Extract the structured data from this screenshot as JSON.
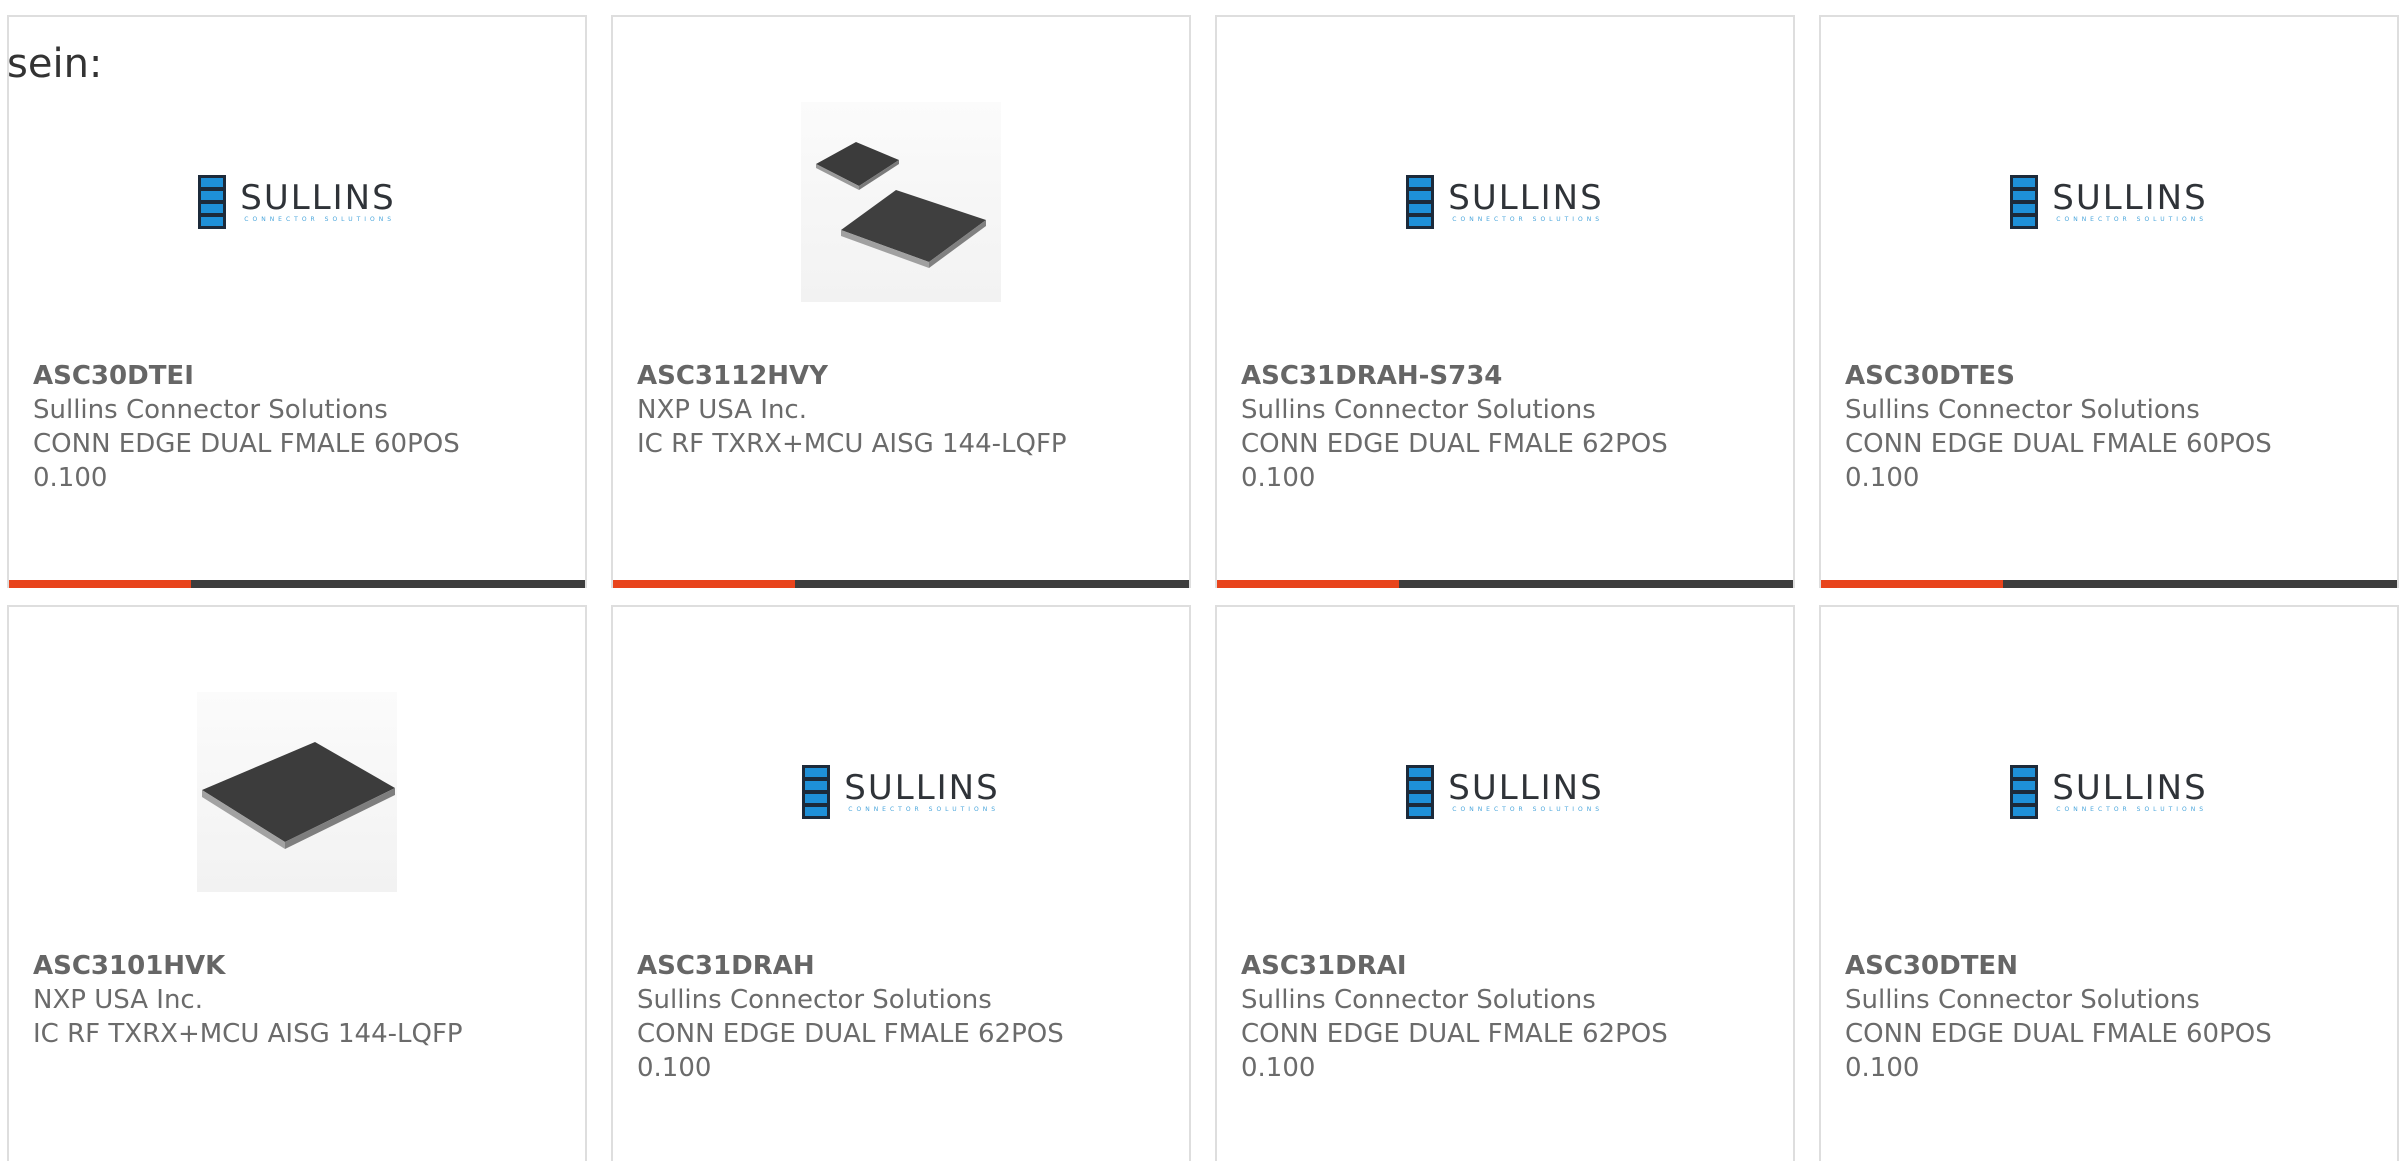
{
  "intro_text": "sein:",
  "colors": {
    "accent": "#e8441c",
    "bar": "#3d3d3d",
    "border": "#dedede",
    "logo_blue": "#1e90d8"
  },
  "logo": {
    "name": "SULLINS",
    "tagline": "CONNECTOR SOLUTIONS"
  },
  "products": [
    {
      "part_number": "ASC30DTEI",
      "manufacturer": "Sullins Connector Solutions",
      "desc_1": "CONN EDGE DUAL FMALE 60POS",
      "desc_2": "0.100",
      "image": "sullins-logo",
      "has_bar": true
    },
    {
      "part_number": "ASC3112HVY",
      "manufacturer": "NXP USA Inc.",
      "desc_1": "IC RF TXRX+MCU AISG 144-LQFP",
      "desc_2": "",
      "image": "ic-chip-pair",
      "has_bar": true
    },
    {
      "part_number": "ASC31DRAH-S734",
      "manufacturer": "Sullins Connector Solutions",
      "desc_1": "CONN EDGE DUAL FMALE 62POS",
      "desc_2": "0.100",
      "image": "sullins-logo",
      "has_bar": true
    },
    {
      "part_number": "ASC30DTES",
      "manufacturer": "Sullins Connector Solutions",
      "desc_1": "CONN EDGE DUAL FMALE 60POS",
      "desc_2": "0.100",
      "image": "sullins-logo",
      "has_bar": true
    },
    {
      "part_number": "ASC3101HVK",
      "manufacturer": "NXP USA Inc.",
      "desc_1": "IC RF TXRX+MCU AISG 144-LQFP",
      "desc_2": "",
      "image": "ic-chip-single",
      "has_bar": false
    },
    {
      "part_number": "ASC31DRAH",
      "manufacturer": "Sullins Connector Solutions",
      "desc_1": "CONN EDGE DUAL FMALE 62POS",
      "desc_2": "0.100",
      "image": "sullins-logo",
      "has_bar": false
    },
    {
      "part_number": "ASC31DRAI",
      "manufacturer": "Sullins Connector Solutions",
      "desc_1": "CONN EDGE DUAL FMALE 62POS",
      "desc_2": "0.100",
      "image": "sullins-logo",
      "has_bar": false
    },
    {
      "part_number": "ASC30DTEN",
      "manufacturer": "Sullins Connector Solutions",
      "desc_1": "CONN EDGE DUAL FMALE 60POS",
      "desc_2": "0.100",
      "image": "sullins-logo",
      "has_bar": false
    }
  ]
}
